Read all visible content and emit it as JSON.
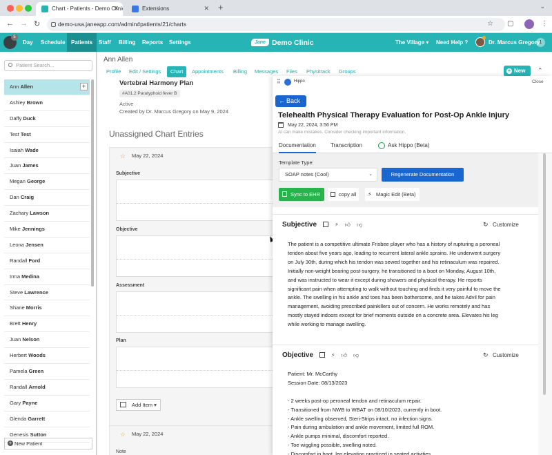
{
  "browser": {
    "tabs": [
      {
        "title": "Chart - Patients - Demo Clinic",
        "active": true
      },
      {
        "title": "Extensions",
        "active": false
      }
    ],
    "url": "demo-usa.janeapp.com/admin#patients/21/charts"
  },
  "nav": {
    "logo_badge": "5",
    "items": [
      "Day",
      "Schedule",
      "Patients",
      "Staff",
      "Billing",
      "Reports",
      "Settings"
    ],
    "active": "Patients",
    "brand_logo": "Jane",
    "brand": "Demo Clinic",
    "location": "The Village",
    "help": "Need Help ?",
    "user": "Dr. Marcus Gregory",
    "user_count": "1"
  },
  "sidebar": {
    "search_placeholder": "Patient Search...",
    "patients": [
      {
        "first": "Ann",
        "last": "Allen"
      },
      {
        "first": "Ashley",
        "last": "Brown"
      },
      {
        "first": "Daffy",
        "last": "Duck"
      },
      {
        "first": "Test",
        "last": "Test"
      },
      {
        "first": "Isaiah",
        "last": "Wade"
      },
      {
        "first": "Juan",
        "last": "James"
      },
      {
        "first": "Megan",
        "last": "George"
      },
      {
        "first": "Dan",
        "last": "Craig"
      },
      {
        "first": "Zachary",
        "last": "Lawson"
      },
      {
        "first": "Mike",
        "last": "Jennings"
      },
      {
        "first": "Leona",
        "last": "Jensen"
      },
      {
        "first": "Randall",
        "last": "Ford"
      },
      {
        "first": "Irma",
        "last": "Medina"
      },
      {
        "first": "Steve",
        "last": "Lawrence"
      },
      {
        "first": "Shane",
        "last": "Morris"
      },
      {
        "first": "Brett",
        "last": "Henry"
      },
      {
        "first": "Juan",
        "last": "Nelson"
      },
      {
        "first": "Herbert",
        "last": "Woods"
      },
      {
        "first": "Pamela",
        "last": "Green"
      },
      {
        "first": "Randall",
        "last": "Arnold"
      },
      {
        "first": "Gary",
        "last": "Payne"
      },
      {
        "first": "Glenda",
        "last": "Garrett"
      },
      {
        "first": "Genesis",
        "last": "Sutton"
      }
    ],
    "new_patient": "New Patient"
  },
  "patient": {
    "name": "Ann Allen",
    "tabs": [
      "Profile",
      "Edit / Settings",
      "Chart",
      "Appointments",
      "Billing",
      "Messages",
      "Files",
      "Physitrack",
      "Groups"
    ],
    "active_tab": "Chart",
    "new_button": "New"
  },
  "chart": {
    "plan_title": "Vertebral Harmony Plan",
    "plan_tag": "#A01.2 Paratyphoid fever B",
    "plan_status": "Active",
    "plan_created": "Created by Dr. Marcus Gregory on May 9, 2024",
    "unassigned_heading": "Unassigned Chart Entries",
    "entry1_date": "May 22, 2024",
    "sections": [
      "Subjective",
      "Objective",
      "Assessment",
      "Plan"
    ],
    "add_item": "Add Item",
    "entry2_date": "May 22, 2024",
    "entry2_label": "Note"
  },
  "hippo": {
    "app_name": "Hippo",
    "close": "Close",
    "back": "Back",
    "title": "Telehealth Physical Therapy Evaluation for Post-Op Ankle Injury",
    "date": "May 22, 2024, 3:56 PM",
    "disclaimer": "AI can make mistakes. Consider checking important information.",
    "tabs": [
      "Documentation",
      "Transcription",
      "Ask Hippo (Beta)"
    ],
    "template_label": "Template Type:",
    "template_value": "SOAP notes (Cool)",
    "regenerate": "Regenerate Documentation",
    "sync": "Sync to EHR",
    "copy_all": "copy all",
    "magic_edit": "Magic Edit (Beta)",
    "customize": "Customize",
    "subjective_heading": "Subjective",
    "subjective_lines": [
      "The patient is a competitive ultimate Frisbee player who has a history of rupturing a peroneal",
      "tendon about five years ago, leading to recurrent lateral ankle sprains. He underwent surgery",
      "on July 30th, during which his tendon was sewed together and his retinaculum was repaired.",
      "Initially non-weight bearing post-surgery, he transitioned to a boot on Monday, August 10th,",
      "and was instructed to wear it except during showers and physical therapy. He reports",
      "significant pain when attempting to walk without touching and finds it very painful to move the",
      "ankle. The swelling in his ankle and toes has been bothersome, and he takes Advil for pain",
      "management, avoiding prescribed painkillers out of concern. He works remotely and has",
      "mostly stayed indoors except for brief moments outside on a concrete area. Elevates his leg",
      "while working to manage swelling."
    ],
    "objective_heading": "Objective",
    "objective_lines": [
      "Patient: Mr. McCarthy",
      "Session Date: 08/13/2023",
      "",
      "- 2 weeks post-op peroneal tendon and retinaculum repair.",
      "- Transitioned from NWB to WBAT on 08/10/2023, currently in boot.",
      "- Ankle swelling observed, Steri-Strips intact, no infection signs.",
      "- Pain during ambulation and ankle movement, limited full ROM.",
      "- Ankle pumps minimal, discomfort reported.",
      "- Toe wiggling possible, swelling noted.",
      "- Discomfort in boot, leg elevation practiced in seated activities."
    ]
  }
}
